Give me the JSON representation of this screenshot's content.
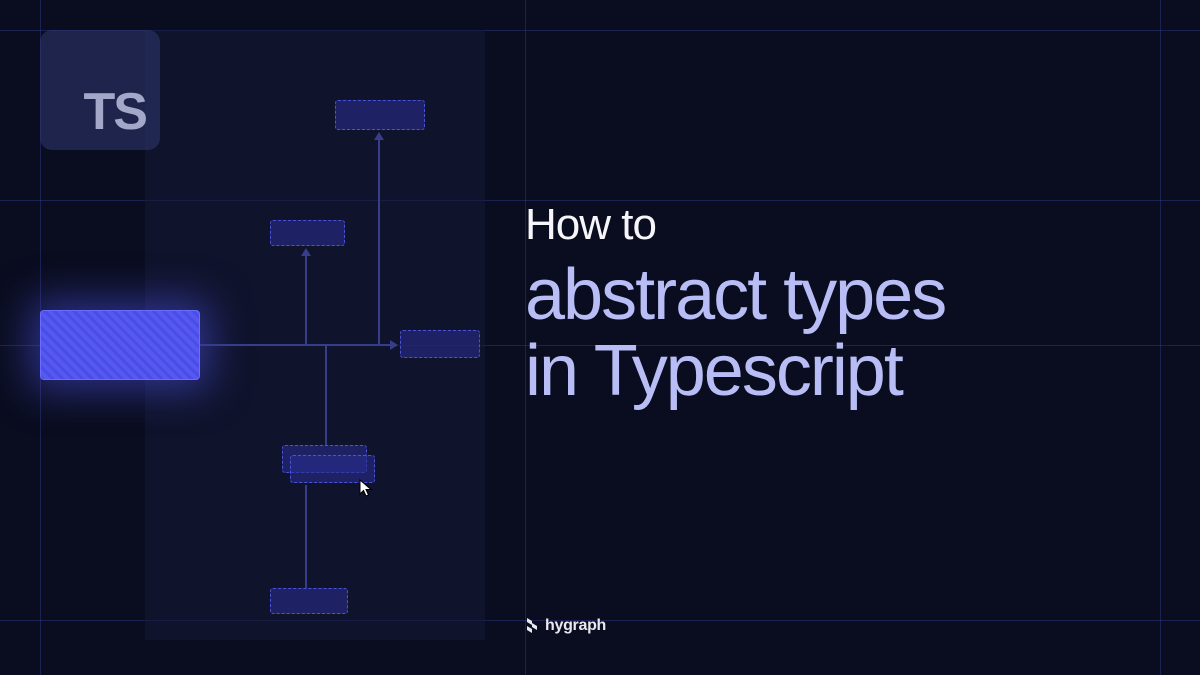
{
  "ts_badge": "TS",
  "title": {
    "line1": "How to",
    "line2": "abstract types",
    "line3": "in Typescript"
  },
  "brand": "hygraph"
}
